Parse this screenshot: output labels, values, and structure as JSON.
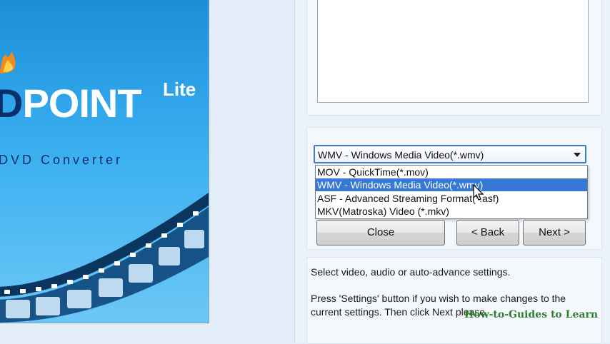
{
  "banner": {
    "brand_left": "D",
    "brand_right": "POINT",
    "edition": "Lite",
    "tagline": "DVD Converter"
  },
  "format_select": {
    "selected": "WMV - Windows Media Video(*.wmv)",
    "options": [
      "MOV - QuickTime(*.mov)",
      "WMV - Windows Media Video(*.wmv)",
      "ASF - Advanced Streaming Format(*.asf)",
      "MKV(Matroska) Video (*.mkv)"
    ],
    "highlighted_index": 1
  },
  "buttons": {
    "close": "Close",
    "back": "< Back",
    "next": "Next >"
  },
  "info": {
    "line1": "Select video, audio  or auto-advance settings.",
    "line2": "Press 'Settings' button if you wish to make changes to the current settings. Then click Next please."
  },
  "watermark": "How-to-Guides to Learn",
  "colors": {
    "banner_blue": "#2ea3ea",
    "selection": "#3778d6",
    "watermark": "#2f7f2f"
  }
}
